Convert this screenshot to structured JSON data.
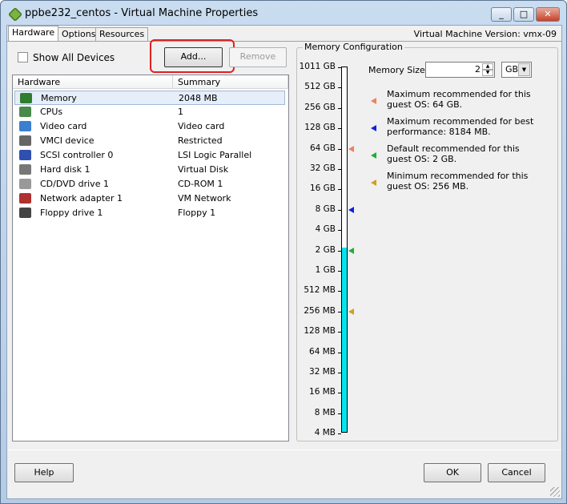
{
  "window": {
    "title": "ppbe232_centos - Virtual Machine Properties",
    "version": "Virtual Machine Version: vmx-09"
  },
  "tabs": [
    {
      "label": "Hardware"
    },
    {
      "label": "Options"
    },
    {
      "label": "Resources"
    }
  ],
  "toolbar": {
    "show_all_devices": "Show All Devices",
    "add": "Add...",
    "remove": "Remove"
  },
  "table": {
    "columns": [
      "Hardware",
      "Summary"
    ],
    "rows": [
      {
        "name": "Memory",
        "summary": "2048 MB",
        "icon": "memory-icon"
      },
      {
        "name": "CPUs",
        "summary": "1",
        "icon": "cpu-icon"
      },
      {
        "name": "Video card",
        "summary": "Video card",
        "icon": "monitor-icon"
      },
      {
        "name": "VMCI device",
        "summary": "Restricted",
        "icon": "vmci-icon"
      },
      {
        "name": "SCSI controller 0",
        "summary": "LSI Logic Parallel",
        "icon": "scsi-icon"
      },
      {
        "name": "Hard disk 1",
        "summary": "Virtual Disk",
        "icon": "disk-icon"
      },
      {
        "name": "CD/DVD drive 1",
        "summary": "CD-ROM 1",
        "icon": "cdrom-icon"
      },
      {
        "name": "Network adapter 1",
        "summary": "VM Network",
        "icon": "network-icon"
      },
      {
        "name": "Floppy drive 1",
        "summary": "Floppy 1",
        "icon": "floppy-icon"
      }
    ]
  },
  "memory": {
    "group_title": "Memory Configuration",
    "size_label": "Memory Size:",
    "size_value": "2",
    "unit": "GB",
    "scale": [
      "1011 GB",
      "512 GB",
      "256 GB",
      "128 GB",
      "64 GB",
      "32 GB",
      "16 GB",
      "8 GB",
      "4 GB",
      "2 GB",
      "1 GB",
      "512 MB",
      "256 MB",
      "128 MB",
      "64 MB",
      "32 MB",
      "16 MB",
      "8 MB",
      "4 MB"
    ],
    "current": "2 GB",
    "fill_color": "#00e5ee",
    "legend": [
      {
        "line1": "Maximum recommended for this",
        "line2": "guest OS: 64 GB.",
        "color": "#f08060",
        "at": "64 GB"
      },
      {
        "line1": "Maximum recommended for best",
        "line2": "performance: 8184 MB.",
        "color": "#1020e0",
        "at": "8 GB"
      },
      {
        "line1": "Default recommended for this",
        "line2": "guest OS: 2 GB.",
        "color": "#20b030",
        "at": "2 GB"
      },
      {
        "line1": "Minimum recommended for this",
        "line2": "guest OS: 256 MB.",
        "color": "#d0a020",
        "at": "256 MB"
      }
    ]
  },
  "footer": {
    "help": "Help",
    "ok": "OK",
    "cancel": "Cancel"
  }
}
